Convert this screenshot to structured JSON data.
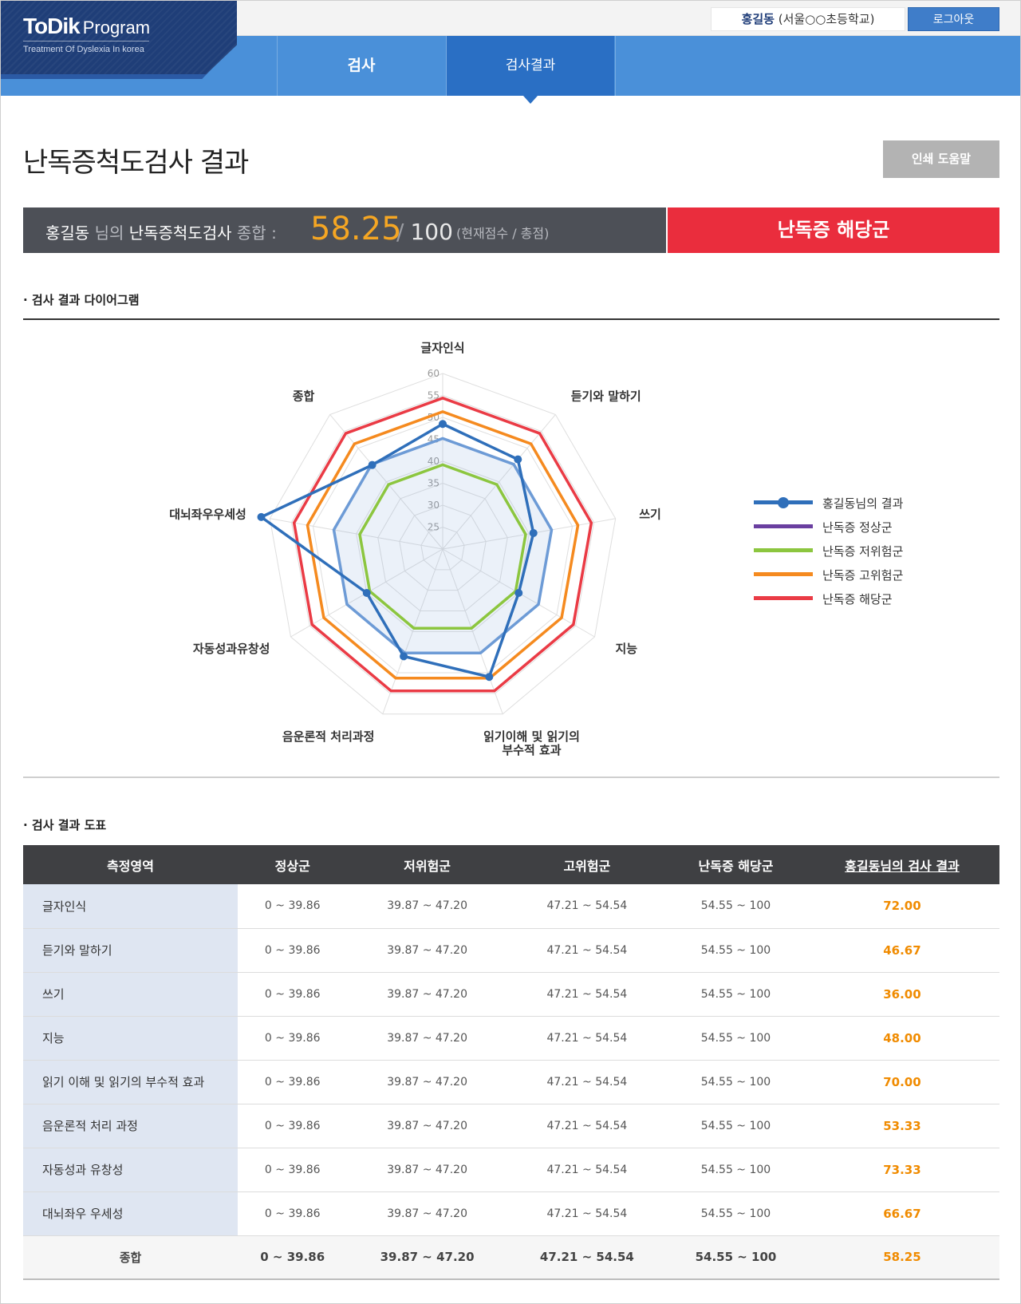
{
  "header": {
    "logo_main": "ToDik",
    "logo_program": "Program",
    "logo_sub": "Treatment Of Dyslexia In korea",
    "user_name": "홍길동",
    "user_school": "(서울○○초등학교)",
    "logout_label": "로그아웃",
    "nav": [
      {
        "label": "검사"
      },
      {
        "label": "검사결과"
      }
    ]
  },
  "page": {
    "title": "난독증척도검사 결과",
    "print_label": "인쇄 도움말"
  },
  "summary": {
    "name": "홍길동",
    "suffix_dim": "님의",
    "test_name": "난독증척도검사",
    "total_label": "종합 :",
    "score": "58.25",
    "slash": "/",
    "max": "100",
    "unit_note": "(현재점수 / 총점)",
    "status": "난독증 해당군"
  },
  "sections": {
    "diagram_title": "· 검사 결과 다이어그램",
    "table_title": "· 검사 결과 도표"
  },
  "chart_data": {
    "type": "radar",
    "axes": [
      "글자인식",
      "듣기와 말하기",
      "쓰기",
      "지능",
      "읽기이해 및 읽기의 부수적 효과",
      "음운론적 처리과정",
      "자동성과유창성",
      "대뇌좌우우세성",
      "종합"
    ],
    "axis_label_lines": [
      [
        "글자인식"
      ],
      [
        "듣기와 말하기"
      ],
      [
        "쓰기"
      ],
      [
        "지능"
      ],
      [
        "읽기이해 및 읽기의",
        "부수적 효과"
      ],
      [
        "음운론적 처리과정"
      ],
      [
        "자동성과유창성"
      ],
      [
        "대뇌좌우우세성"
      ],
      [
        "종합"
      ]
    ],
    "rlim": [
      20,
      60
    ],
    "ticks": [
      25,
      30,
      35,
      40,
      45,
      50,
      55,
      60
    ],
    "series": [
      {
        "name": "홍길동님의 결과",
        "color": "#2f6fba",
        "markers": true,
        "values": [
          48.5,
          46.67,
          41.0,
          40.0,
          51.0,
          46.0,
          40.0,
          62.0,
          45.0
        ]
      },
      {
        "name": "난독증 정상군",
        "color": "#6a3fa0",
        "values": [
          45.2,
          45.2,
          45.2,
          45.2,
          45.2,
          45.2,
          45.2,
          45.2,
          45.2
        ]
      },
      {
        "name": "난독증 저위험군",
        "color": "#8cc63f",
        "values": [
          39.2,
          39.2,
          39.2,
          39.2,
          39.2,
          39.2,
          39.2,
          39.2,
          39.2
        ]
      },
      {
        "name": "난독증 고위험군",
        "color": "#f58a1f",
        "values": [
          51.3,
          51.3,
          51.3,
          51.3,
          51.3,
          51.3,
          51.3,
          51.3,
          51.3
        ]
      },
      {
        "name": "난독증 해당군",
        "color": "#ea3b45",
        "values": [
          54.4,
          54.4,
          54.4,
          54.4,
          54.4,
          54.4,
          54.4,
          54.4,
          54.4
        ]
      }
    ],
    "legend": [
      "홍길동님의 결과",
      "난독증 정상군",
      "난독증 저위험군",
      "난독증 고위험군",
      "난독증 해당군"
    ],
    "legend_position": "right"
  },
  "table": {
    "headers": [
      "측정영역",
      "정상군",
      "저위험군",
      "고위험군",
      "난독증 해당군",
      "홍길동님의 검사 결과"
    ],
    "rows": [
      {
        "area": "글자인식",
        "normal": "0 ~ 39.86",
        "low": "39.87 ~ 47.20",
        "high": "47.21 ~ 54.54",
        "dys": "54.55 ~ 100",
        "result": "72.00"
      },
      {
        "area": "듣기와 말하기",
        "normal": "0 ~ 39.86",
        "low": "39.87 ~ 47.20",
        "high": "47.21 ~ 54.54",
        "dys": "54.55 ~ 100",
        "result": "46.67"
      },
      {
        "area": "쓰기",
        "normal": "0 ~ 39.86",
        "low": "39.87 ~ 47.20",
        "high": "47.21 ~ 54.54",
        "dys": "54.55 ~ 100",
        "result": "36.00"
      },
      {
        "area": "지능",
        "normal": "0 ~ 39.86",
        "low": "39.87 ~ 47.20",
        "high": "47.21 ~ 54.54",
        "dys": "54.55 ~ 100",
        "result": "48.00"
      },
      {
        "area": "읽기 이해 및 읽기의 부수적 효과",
        "normal": "0 ~ 39.86",
        "low": "39.87 ~ 47.20",
        "high": "47.21 ~ 54.54",
        "dys": "54.55 ~ 100",
        "result": "70.00"
      },
      {
        "area": "음운론적 처리 과정",
        "normal": "0 ~ 39.86",
        "low": "39.87 ~ 47.20",
        "high": "47.21 ~ 54.54",
        "dys": "54.55 ~ 100",
        "result": "53.33"
      },
      {
        "area": "자동성과 유창성",
        "normal": "0 ~ 39.86",
        "low": "39.87 ~ 47.20",
        "high": "47.21 ~ 54.54",
        "dys": "54.55 ~ 100",
        "result": "73.33"
      },
      {
        "area": "대뇌좌우 우세성",
        "normal": "0 ~ 39.86",
        "low": "39.87 ~ 47.20",
        "high": "47.21 ~ 54.54",
        "dys": "54.55 ~ 100",
        "result": "66.67"
      }
    ],
    "total": {
      "area": "종합",
      "normal": "0 ~ 39.86",
      "low": "39.87 ~ 47.20",
      "high": "47.21 ~ 54.54",
      "dys": "54.55 ~ 100",
      "result": "58.25"
    }
  },
  "colors": {
    "nav_blue": "#4a90d9",
    "nav_active": "#2a6fc4",
    "logo_navy": "#1f3e78",
    "score_orange": "#f5a623",
    "status_red": "#ea2d3d",
    "result_orange": "#f08b00"
  }
}
